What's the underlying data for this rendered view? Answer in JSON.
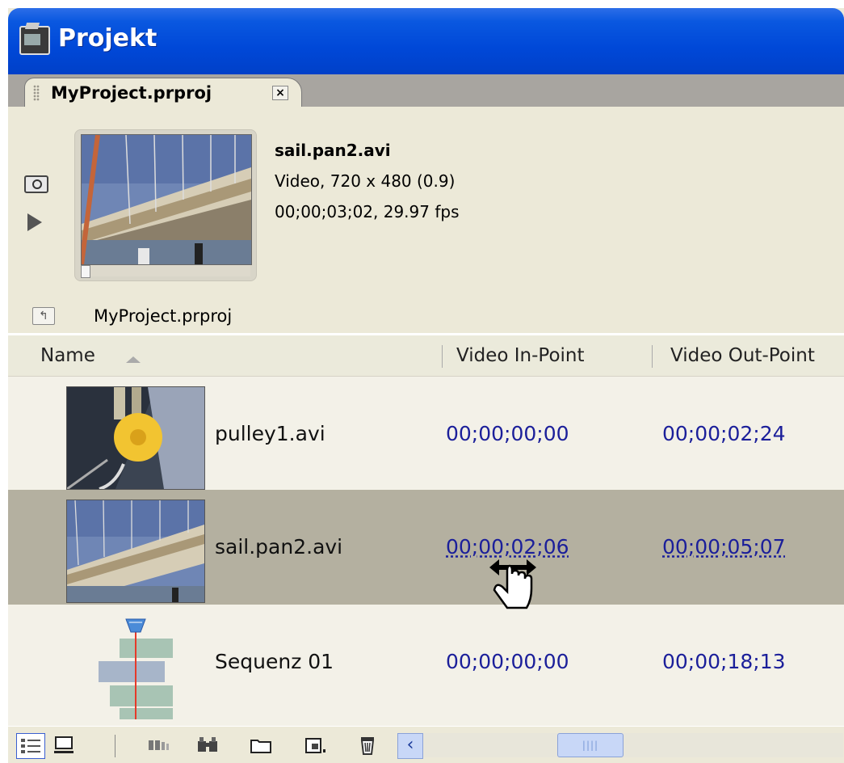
{
  "window": {
    "title": "Projekt"
  },
  "tab": {
    "label": "MyProject.prproj",
    "close": "×"
  },
  "preview": {
    "clip_name": "sail.pan2.avi",
    "line1": "Video, 720 x 480 (0.9)",
    "line2": "00;00;03;02, 29.97 fps"
  },
  "bin": {
    "path": "MyProject.prproj"
  },
  "columns": {
    "name": "Name",
    "in_point": "Video In-Point",
    "out_point": "Video Out-Point"
  },
  "rows": [
    {
      "name": "pulley1.avi",
      "in": "00;00;00;00",
      "out": "00;00;02;24"
    },
    {
      "name": "sail.pan2.avi",
      "in": "00;00;02;06",
      "out": "00;00;05;07"
    },
    {
      "name": "Sequenz 01",
      "in": "00;00;00;00",
      "out": "00;00;18;13"
    }
  ],
  "icons": {
    "toolbar": [
      "list-view-icon",
      "icon-view-icon",
      "automate-to-sequence-icon",
      "find-icon",
      "new-bin-icon",
      "new-item-icon",
      "clear-icon"
    ]
  },
  "colors": {
    "titlebar": "#0048d8",
    "timecode": "#1b1f9a",
    "selected_row": "#b4b0a0"
  }
}
